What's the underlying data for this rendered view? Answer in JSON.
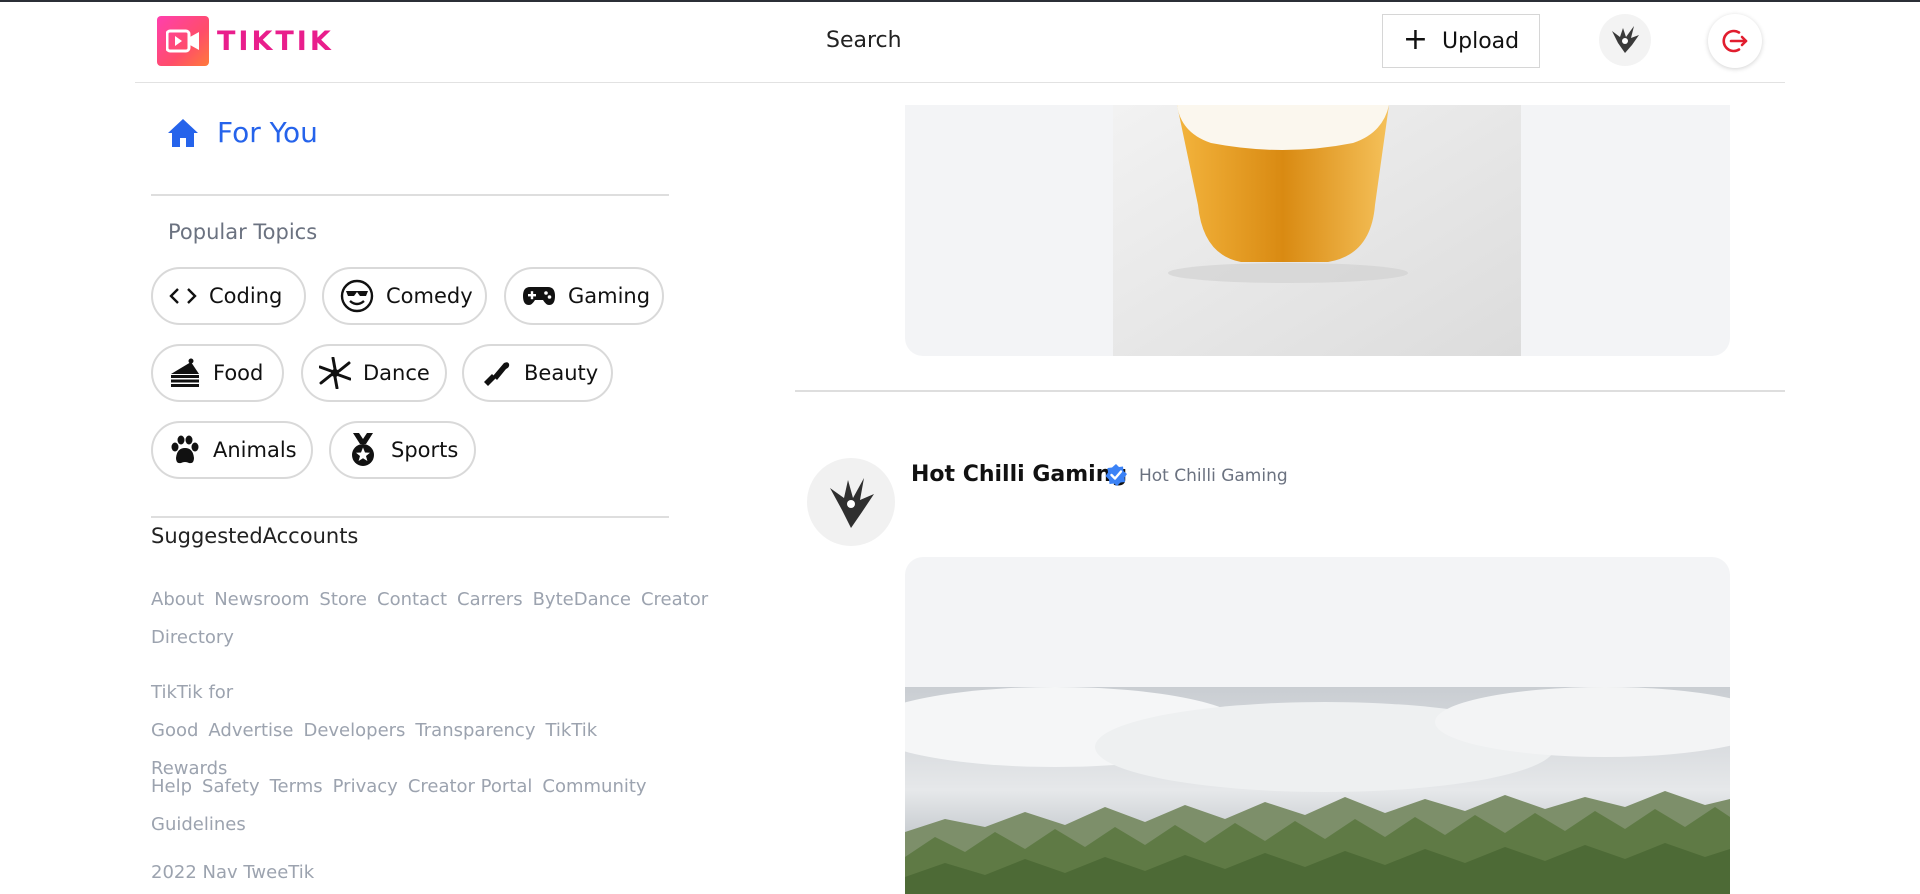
{
  "header": {
    "logo_text": "TIKTIK",
    "search_label": "Search",
    "upload_label": "Upload"
  },
  "sidebar": {
    "home_label": "For You",
    "popular_title": "Popular Topics",
    "topics": [
      {
        "label": "Coding",
        "icon": "code-icon"
      },
      {
        "label": "Comedy",
        "icon": "smile-sunglasses-icon"
      },
      {
        "label": "Gaming",
        "icon": "gamepad-icon"
      },
      {
        "label": "Food",
        "icon": "cake-slice-icon"
      },
      {
        "label": "Dance",
        "icon": "dance-icon"
      },
      {
        "label": "Beauty",
        "icon": "lipstick-icon"
      },
      {
        "label": "Animals",
        "icon": "paw-icon"
      },
      {
        "label": "Sports",
        "icon": "medal-icon"
      }
    ],
    "suggested_title": "SuggestedAccounts",
    "footer_links_1": [
      "About",
      "Newsroom",
      "Store",
      "Contact",
      "Carrers",
      "ByteDance",
      "Creator Directory"
    ],
    "footer_links_2": [
      "TikTik for Good",
      "Advertise",
      "Developers",
      "Transparency",
      "TikTik Rewards"
    ],
    "footer_links_3": [
      "Help",
      "Safety",
      "Terms",
      "Privacy",
      "Creator Portal",
      "Community Guidelines"
    ],
    "copyright": "2022 Nav TweeTik"
  },
  "feed": {
    "post": {
      "username": "Hot Chilli Gaming",
      "display_name": "Hot Chilli Gaming"
    }
  },
  "colors": {
    "accent": "#2563eb",
    "brand": "#e91e8c",
    "logout": "#e11d2e"
  }
}
